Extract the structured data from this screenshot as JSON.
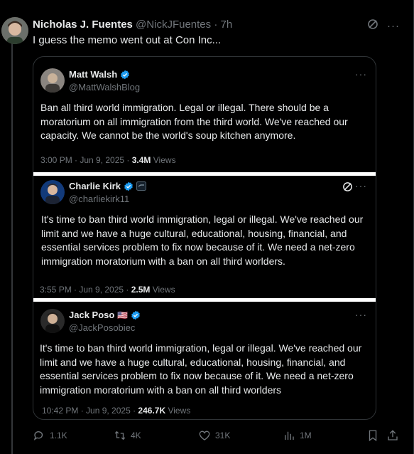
{
  "post": {
    "name": "Nicholas J. Fuentes",
    "handle": "@NickJFuentes",
    "dot": "·",
    "time": "7h",
    "text": "I guess the memo went out at Con Inc...",
    "more": "···"
  },
  "quotes": [
    {
      "name": "Matt Walsh",
      "handle": "@MattWalshBlog",
      "text": "Ban all third world immigration. Legal or illegal. There should be a moratorium on all immigration from the third world. We've reached our capacity. We cannot be the world's soup kitchen anymore.",
      "time": "3:00 PM · Jun 9, 2025 · ",
      "views": "3.4M",
      "views_label": " Views",
      "more": "···"
    },
    {
      "name": "Charlie Kirk",
      "handle": "@charliekirk11",
      "text": "It's time to ban third world immigration, legal or illegal. We've reached our limit and we have a huge cultural, educational, housing, financial, and essential services problem to fix now because of it. We need a net-zero immigration moratorium with a ban on all third worlders.",
      "time": "3:55 PM · Jun 9, 2025 · ",
      "views": "2.5M",
      "views_label": " Views",
      "more": "···"
    },
    {
      "name": "Jack Poso",
      "flag": "🇺🇸",
      "handle": "@JackPosobiec",
      "text": "It's time to ban third world immigration, legal or illegal. We've reached our limit and we have a huge cultural, educational, housing, financial, and essential services problem to fix now because of it. We need a net-zero immigration moratorium with a ban on all third worlders",
      "time": "10:42 PM · Jun 9, 2025 · ",
      "views": "246.7K",
      "views_label": " Views",
      "more": "···"
    }
  ],
  "actions": {
    "replies": "1.1K",
    "reposts": "4K",
    "likes": "31K",
    "views": "1M"
  },
  "colors": {
    "accent": "#1d9bf0",
    "muted": "#71767b",
    "text": "#e7e9ea"
  }
}
